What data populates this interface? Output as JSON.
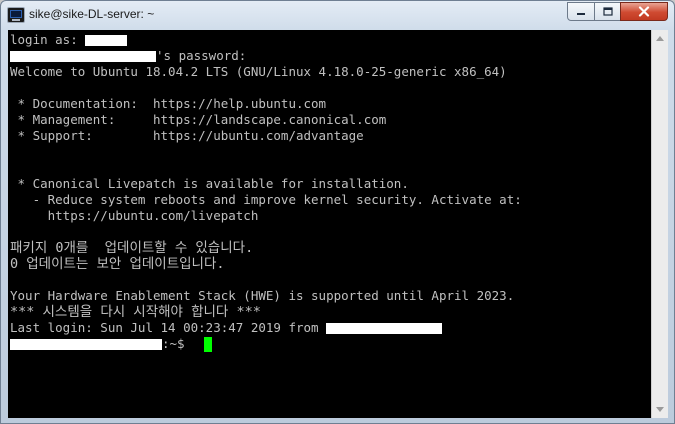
{
  "window": {
    "title": "sike@sike-DL-server: ~"
  },
  "terminal": {
    "lines": [
      "login as: ",
      "'s password:",
      "Welcome to Ubuntu 18.04.2 LTS (GNU/Linux 4.18.0-25-generic x86_64)",
      "",
      " * Documentation:  https://help.ubuntu.com",
      " * Management:     https://landscape.canonical.com",
      " * Support:        https://ubuntu.com/advantage",
      "",
      "",
      " * Canonical Livepatch is available for installation.",
      "   - Reduce system reboots and improve kernel security. Activate at:",
      "     https://ubuntu.com/livepatch",
      "",
      "패키지 0개를  업데이트할 수 있습니다.",
      "0 업데이트는 보안 업데이트입니다.",
      "",
      "Your Hardware Enablement Stack (HWE) is supported until April 2023.",
      "*** 시스템을 다시 시작해야 합니다 ***",
      "Last login: Sun Jul 14 00:23:47 2019 from ",
      ":~$ "
    ]
  },
  "colors": {
    "terminal_bg": "#000000",
    "terminal_fg": "#c0c0c0",
    "cursor": "#00ff00",
    "close_button": "#c23a22"
  },
  "icons": {
    "app": "putty-terminal-icon",
    "minimize": "minimize-icon",
    "maximize": "maximize-icon",
    "close": "close-icon",
    "scroll_up": "scroll-up-arrow-icon",
    "scroll_down": "scroll-down-arrow-icon"
  }
}
